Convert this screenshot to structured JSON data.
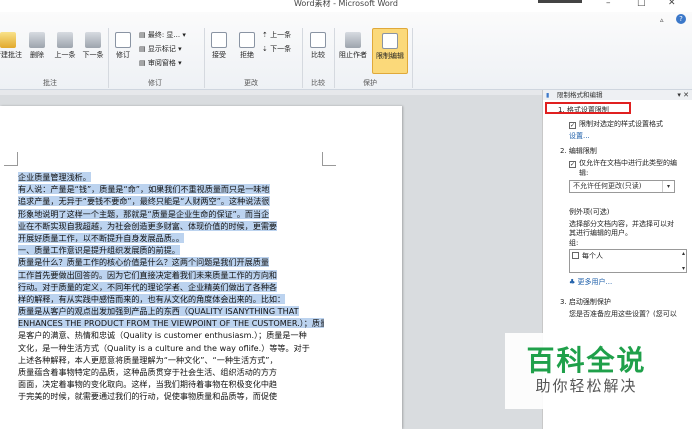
{
  "window": {
    "title": "Word素材 - Microsoft Word",
    "min": "–",
    "max": "□",
    "close": "✕",
    "help": "?"
  },
  "ribbon": {
    "comments": {
      "new": "新建批注",
      "delete": "删除",
      "prev": "上一条",
      "next": "下一条",
      "group": "批注"
    },
    "tracking": {
      "track": "修订",
      "display": "最终: 显...",
      "markup": "显示标记",
      "pane": "审阅窗格",
      "group": "修订"
    },
    "changes": {
      "accept": "接受",
      "reject": "拒绝",
      "prev": "上一条",
      "next": "下一条",
      "group": "更改"
    },
    "compare": {
      "label": "比较",
      "group": "比较"
    },
    "protect": {
      "block": "阻止作者",
      "restrict": "限制编辑",
      "group": "保护"
    }
  },
  "document": {
    "lines": [
      {
        "text": "企业质量管理浅析。",
        "highlight": true
      },
      {
        "text": "有人说：产量是“钱”，质量是“命”，如果我们不重视质量而只是一味地",
        "highlight": true
      },
      {
        "text": "追求产量，无异于“要钱不要命”，最终只能是“人财两空”。这种说法很",
        "highlight": true
      },
      {
        "text": "形象地说明了这样一个主题，那就是“质量是企业生命的保证”。而当企",
        "highlight": true
      },
      {
        "text": "业在不断实现自我超越，为社会创造更多财富、体现价值的时候，更需要",
        "highlight": true
      },
      {
        "text": "开展好质量工作，以不断提升自身发展品质。。",
        "highlight": true
      },
      {
        "text": "一、质量工作意识是提升组织发展质的前提。",
        "highlight": true
      },
      {
        "text": "质量是什么？质量工作的核心价值是什么？这两个问题是我们开展质量",
        "highlight": true
      },
      {
        "text": "工作首先要做出回答的。因为它们直接决定着我们未来质量工作的方向和",
        "highlight": true
      },
      {
        "text": "行动。对于质量的定义，不同年代的理论学者、企业精英们做出了各种各",
        "highlight": true
      },
      {
        "text": "样的解释，有从实践中感悟而来的，也有从文化的角度体会出来的。比如：",
        "highlight": true
      },
      {
        "text": "质量是从客户的观点出发加强到产品上的东西（QUALITY ISANYTHING THAT",
        "highlight": true
      },
      {
        "text": "ENHANCES THE PRODUCT FROM THE VIEWPOINT OF THE CUSTOMER.）；质量",
        "highlight": true
      },
      {
        "text": "是客户的满意、热情和忠诚（Quality is customer enthusiasm.）；质量是一种",
        "highlight": false
      },
      {
        "text": "文化，是一种生活方式（Quality is a culture and the way oflife.）等等。对于",
        "highlight": false
      },
      {
        "text": "上述各种解释，本人更愿意将质量理解为“一种文化”、“一种生活方式”，",
        "highlight": false
      },
      {
        "text": "质量蕴含着事物特定的品质，这种品质贯穿于社会生活、组织活动的方方",
        "highlight": false
      },
      {
        "text": "面面，决定着事物的变化取向。这样，当我们期待着事物在积极变化中趋",
        "highlight": false
      },
      {
        "text": "于完美的时候，就需要通过我们的行动，促使事物质量和品质等，而促使",
        "highlight": false
      }
    ]
  },
  "pane": {
    "title": "限制格式和编辑",
    "close": "▾ ✕",
    "section1": "1. 格式设置限制",
    "s1_check": "限制对选定的样式设置格式",
    "s1_link": "设置...",
    "section2": "2. 编辑限制",
    "s2_check1": "仅允许在文档中进行此类型的编",
    "s2_check2": "辑:",
    "s2_select": "不允许任何更改(只读)",
    "exceptions": "例外项(可选)",
    "exc_desc1": "选择部分文档内容，并选择可以对",
    "exc_desc2": "其进行编辑的用户。",
    "group_label": "组:",
    "group_item": "每个人",
    "more_users": "更多用户...",
    "section3": "3. 启动强制保护",
    "s3_desc": "您是否准备应用这些设置？(您可以"
  },
  "watermark": {
    "title": "百科全说",
    "subtitle": "助你轻松解决"
  }
}
